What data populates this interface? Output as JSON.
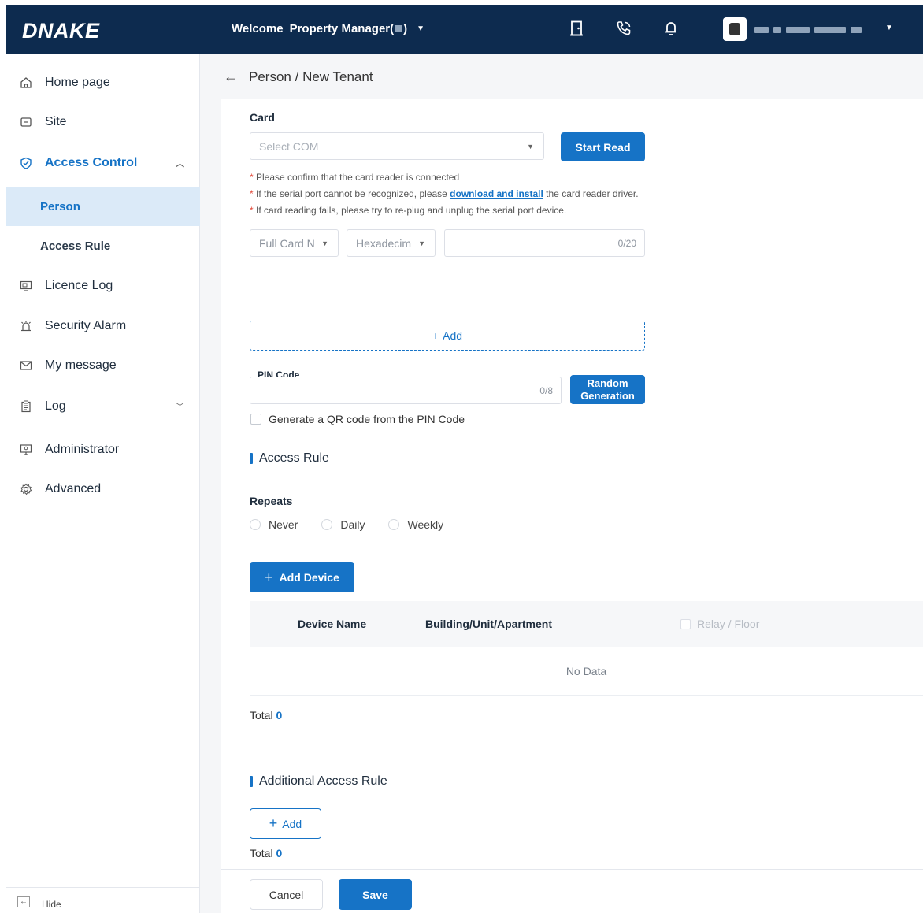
{
  "header": {
    "logo": "DNAKE",
    "welcome": "Welcome",
    "role": "Property Manager(",
    "role_suffix": ")",
    "icons": [
      "door-icon",
      "phone-call-icon",
      "bell-icon"
    ]
  },
  "sidebar": {
    "items": [
      {
        "label": "Home page",
        "icon": "home-icon"
      },
      {
        "label": "Site",
        "icon": "folder-icon"
      },
      {
        "label": "Access Control",
        "icon": "shield-icon"
      },
      {
        "label": "Person"
      },
      {
        "label": "Access Rule"
      },
      {
        "label": "Licence Log",
        "icon": "licence-icon"
      },
      {
        "label": "Security Alarm",
        "icon": "alarm-icon"
      },
      {
        "label": "My message",
        "icon": "mail-icon"
      },
      {
        "label": "Log",
        "icon": "clipboard-icon"
      },
      {
        "label": "Administrator",
        "icon": "monitor-icon"
      },
      {
        "label": "Advanced",
        "icon": "gear-icon"
      }
    ],
    "hide_label": "Hide"
  },
  "breadcrumb": {
    "parent": "Person",
    "separator": "/",
    "current": "New Tenant"
  },
  "card_section": {
    "title": "Card",
    "select_placeholder": "Select COM",
    "start_read": "Start Read",
    "notes": {
      "n1": "Please confirm that the card reader is connected",
      "n2_pre": "If the serial port cannot be recognized, please ",
      "n2_link": "download and install",
      "n2_post": " the card reader driver.",
      "n3": "If card reading fails, please try to re-plug and unplug the serial port device."
    },
    "card_type": "Full Card N",
    "format": "Hexadecim",
    "card_counter": "0/20",
    "add_label": "Add"
  },
  "pin_section": {
    "title": "PIN Code",
    "counter": "0/8",
    "random_line1": "Random",
    "random_line2": "Generation",
    "qr_label": "Generate a QR code from the PIN Code"
  },
  "access_rule": {
    "title": "Access Rule",
    "repeats_title": "Repeats",
    "options": [
      "Never",
      "Daily",
      "Weekly"
    ],
    "add_device": "Add Device",
    "columns": [
      "Device Name",
      "Building/Unit/Apartment",
      "Relay / Floor"
    ],
    "empty": "No Data",
    "total_label": "Total",
    "total_value": "0"
  },
  "additional_rule": {
    "title": "Additional Access Rule",
    "add_label": "Add",
    "total_label": "Total",
    "total_value": "0"
  },
  "footer": {
    "cancel": "Cancel",
    "save": "Save"
  },
  "colors": {
    "primary": "#1673c6",
    "header_bg": "#0d2b4f",
    "selected_bg": "#dbeaf8",
    "required_star": "#e34a3a"
  }
}
